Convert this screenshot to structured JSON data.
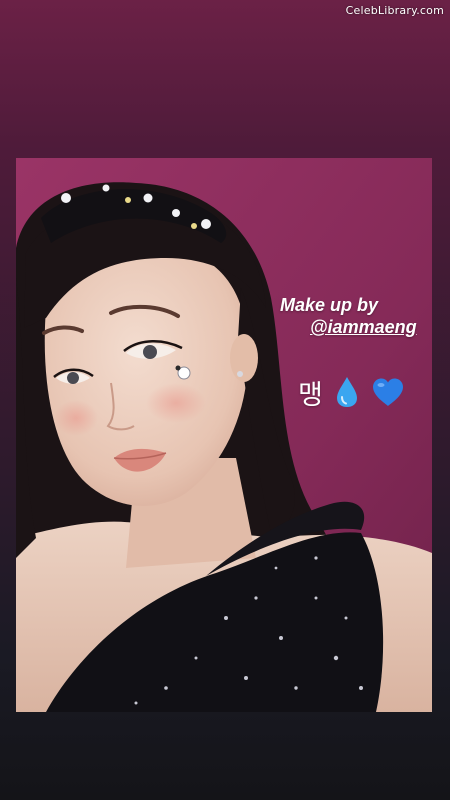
{
  "watermark": {
    "text": "CelebLibrary.com"
  },
  "story": {
    "caption": {
      "line1": "Make up by",
      "mention": "@iammaeng"
    },
    "stickers": {
      "korean_text": "맹",
      "emoji1": "droplet-icon",
      "emoji2": "blue-heart-icon"
    }
  },
  "colors": {
    "background_top": "#6b2146",
    "background_bottom": "#141418",
    "photo_wall": "#8a2d5d",
    "caption_text": "#ffffff",
    "heart_blue": "#2b7fe6",
    "droplet_blue": "#3aa6f0"
  }
}
